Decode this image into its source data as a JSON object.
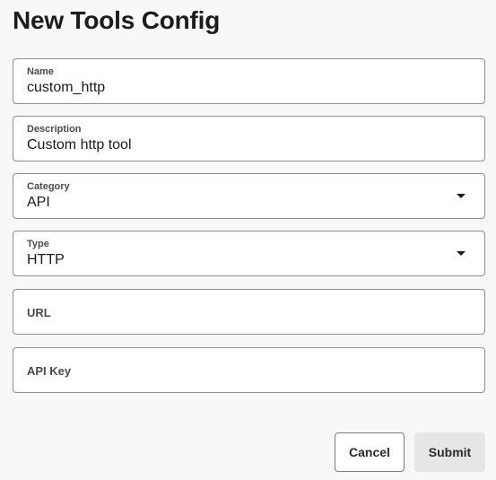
{
  "form": {
    "title": "New Tools Config",
    "fields": [
      {
        "label": "Name",
        "value": "custom_http",
        "kind": "text"
      },
      {
        "label": "Description",
        "value": "Custom http tool",
        "kind": "text"
      },
      {
        "label": "Category",
        "value": "API",
        "kind": "select",
        "icon": "caret-down-icon"
      },
      {
        "label": "Type",
        "value": "HTTP",
        "kind": "select",
        "icon": "caret-down-icon"
      },
      {
        "label": "URL",
        "value": "",
        "kind": "text"
      },
      {
        "label": "API Key",
        "value": "",
        "kind": "text"
      }
    ],
    "buttons": {
      "cancel_label": "Cancel",
      "submit_label": "Submit"
    }
  }
}
